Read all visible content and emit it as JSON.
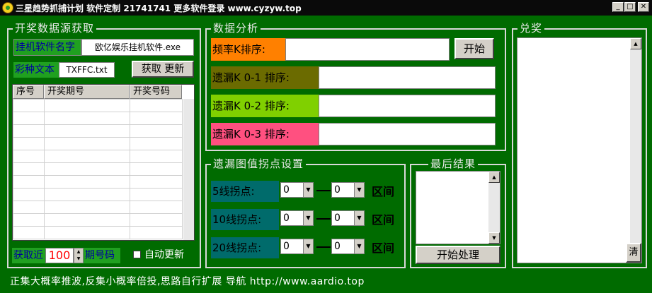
{
  "window": {
    "title": "三星趋势抓捕计划 软件定制 21741741 更多软件登录 www.cyzyw.top",
    "icon": "frog-app-icon"
  },
  "colors": {
    "background": "#006b00",
    "freq": "#ff8000",
    "k01": "#6b6b00",
    "k02": "#80d000",
    "k03": "#ff5080"
  },
  "source": {
    "title": "开奖数据源获取",
    "exe_label": "挂机软件名字",
    "exe_value": "欧亿娱乐挂机软件.exe",
    "lottery_label": "彩种文本",
    "lottery_value": "TXFFC.txt",
    "fetch_button": "获取 更新",
    "columns": [
      "序号",
      "开奖期号",
      "开奖号码"
    ],
    "fetch_prefix": "获取近",
    "fetch_count": "100",
    "fetch_suffix": "期号码",
    "auto_update": "自动更新"
  },
  "analysis": {
    "title": "数据分析",
    "freq_label": "频率K排序:",
    "start_button": "开始",
    "k01_label": "遗漏K 0-1 排序:",
    "k02_label": "遗漏K 0-2 排序:",
    "k03_label": "遗漏K 0-3 排序:"
  },
  "inflection": {
    "title": "遗漏图值拐点设置",
    "rows": [
      {
        "label": "5线拐点:",
        "from": "0",
        "to": "0",
        "range": "区间"
      },
      {
        "label": "10线拐点:",
        "from": "0",
        "to": "0",
        "range": "区间"
      },
      {
        "label": "20线拐点:",
        "from": "0",
        "to": "0",
        "range": "区间"
      }
    ]
  },
  "result": {
    "title": "最后结果",
    "process_button": "开始处理"
  },
  "prize": {
    "title": "兑奖",
    "clear_button": "清"
  },
  "footer": {
    "text": "正集大概率推波,反集小概率倍投,思路自行扩展 导航 http://www.aardio.top"
  }
}
